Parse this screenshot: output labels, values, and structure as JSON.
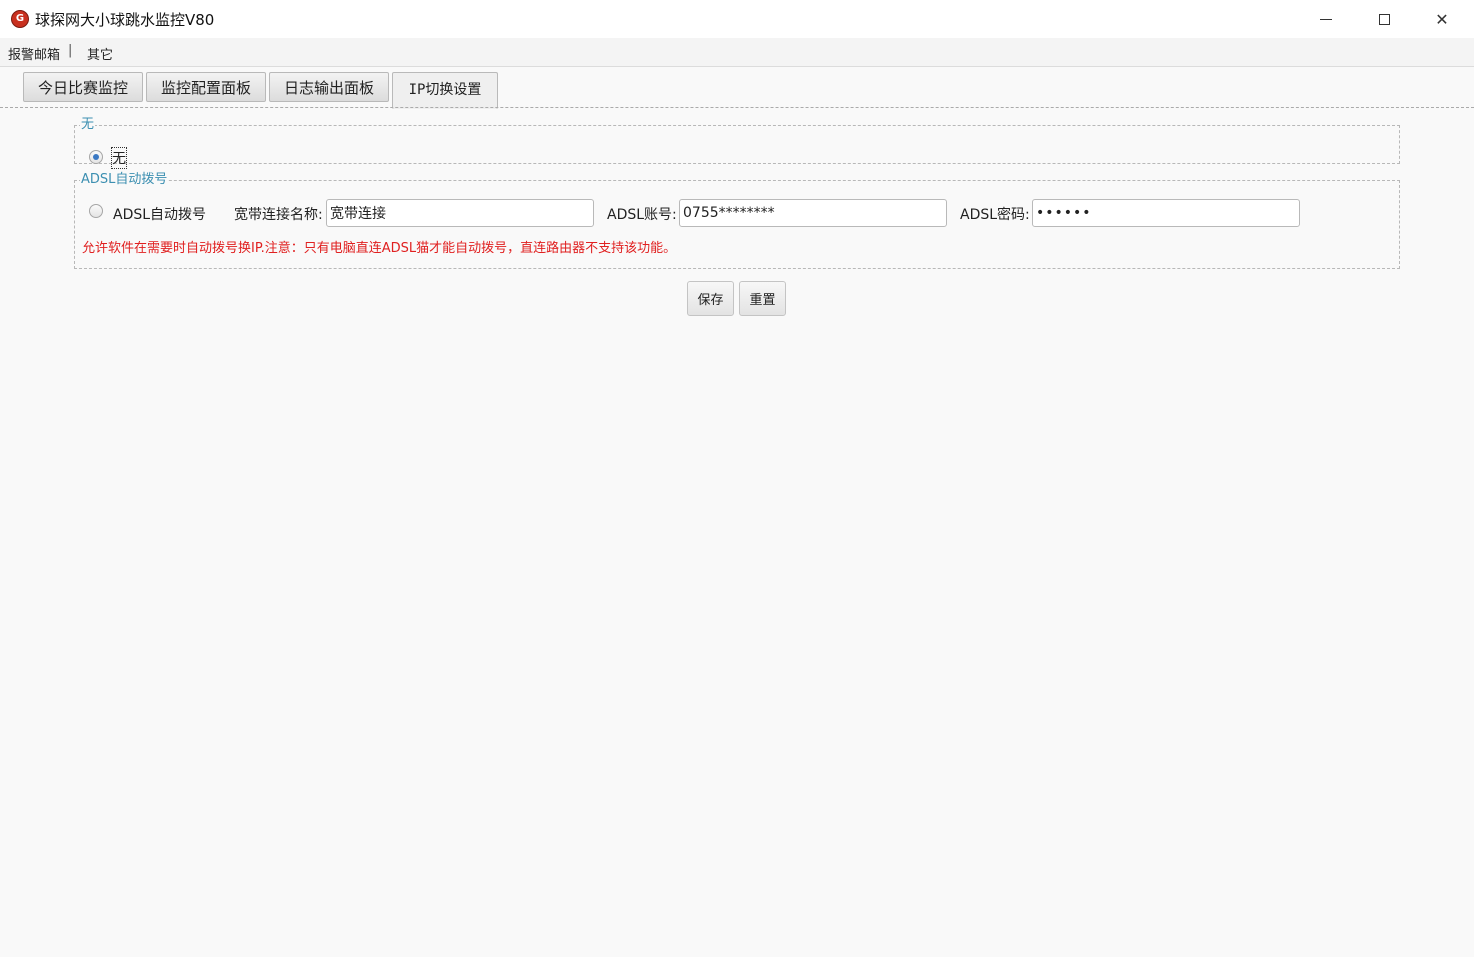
{
  "window": {
    "title": "球探网大小球跳水监控V80",
    "app_icon_glyph": "G",
    "controls": {
      "minimize": "minimize-icon",
      "maximize": "maximize-icon",
      "close": "close-icon",
      "close_glyph": "✕"
    }
  },
  "menu": {
    "items": [
      "报警邮箱",
      "其它"
    ],
    "separator": "|"
  },
  "tabs": [
    {
      "label": "今日比赛监控",
      "active": false
    },
    {
      "label": "监控配置面板",
      "active": false
    },
    {
      "label": "日志输出面板",
      "active": false
    },
    {
      "label": "IP切换设置",
      "active": true
    }
  ],
  "groups": {
    "none": {
      "legend": "无",
      "radio_label": "无",
      "checked": true
    },
    "adsl": {
      "legend": "ADSL自动拨号",
      "radio_label": "ADSL自动拨号",
      "checked": false,
      "connection_name_label": "宽带连接名称:",
      "connection_name_value": "宽带连接",
      "account_label": "ADSL账号:",
      "account_value": "0755********",
      "password_label": "ADSL密码:",
      "password_value": "••••••",
      "warning": "允许软件在需要时自动拨号换IP.注意：只有电脑直连ADSL猫才能自动拨号，直连路由器不支持该功能。"
    }
  },
  "buttons": {
    "save": "保存",
    "reset": "重置"
  },
  "colors": {
    "legend": "#3c8fb1",
    "warning": "#e02020",
    "radio_checked": "#3a78c3"
  }
}
